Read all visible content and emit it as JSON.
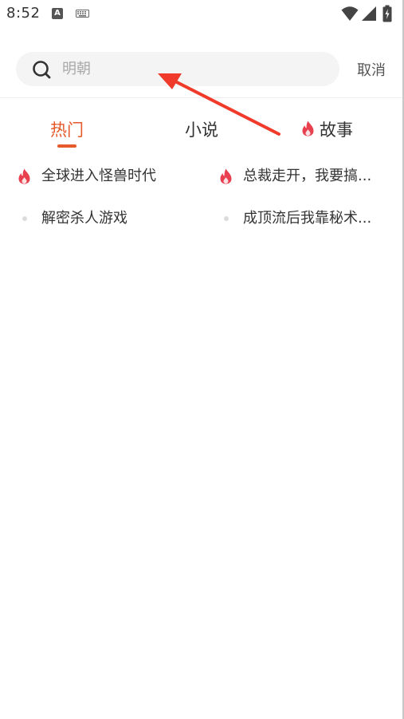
{
  "status_bar": {
    "time": "8:52",
    "icons": [
      "a-notification-icon",
      "keyboard-icon",
      "wifi-icon",
      "signal-icon",
      "battery-icon"
    ]
  },
  "search": {
    "placeholder": "明朝",
    "value": "",
    "cancel_label": "取消"
  },
  "tabs": [
    {
      "label": "热门",
      "active": true
    },
    {
      "label": "小说",
      "active": false
    },
    {
      "label": "故事",
      "active": false,
      "icon": "flame-icon"
    }
  ],
  "hot_list": [
    {
      "label": "全球进入怪兽时代",
      "icon": "flame-icon"
    },
    {
      "label": "总裁走开，我要搞...",
      "icon": "flame-icon"
    },
    {
      "label": "解密杀人游戏",
      "icon": "dot-icon"
    },
    {
      "label": "成顶流后我靠秘术...",
      "icon": "dot-icon"
    }
  ],
  "colors": {
    "accent": "#e5592b",
    "flame": "#e8404f",
    "annotation_arrow": "#f03a2a",
    "search_bg": "#f4f4f4"
  }
}
